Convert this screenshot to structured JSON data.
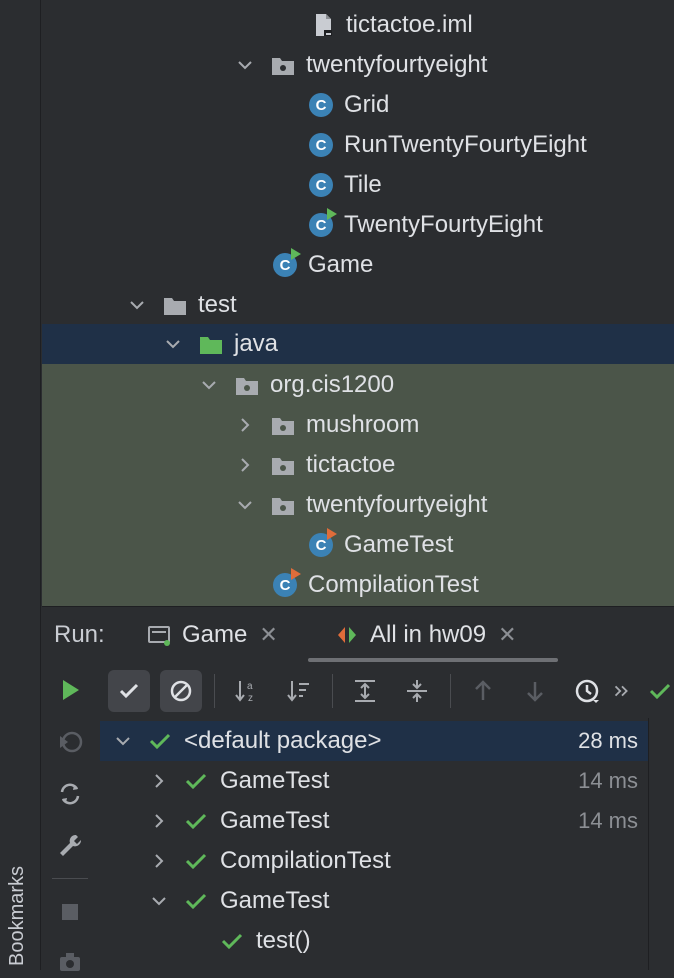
{
  "left_strip": {
    "bookmarks_label": "Bookmarks"
  },
  "project_tree": {
    "rows": [
      {
        "label": "tictactoe.iml",
        "kind": "file"
      },
      {
        "label": "twentyfourtyeight",
        "kind": "package",
        "expanded": true
      },
      {
        "label": "Grid",
        "kind": "class"
      },
      {
        "label": "RunTwentyFourtyEight",
        "kind": "class"
      },
      {
        "label": "Tile",
        "kind": "class"
      },
      {
        "label": "TwentyFourtyEight",
        "kind": "class-runnable"
      },
      {
        "label": "Game",
        "kind": "class-runnable"
      },
      {
        "label": "test",
        "kind": "folder",
        "expanded": true
      },
      {
        "label": "java",
        "kind": "source-root",
        "expanded": true,
        "selected": true
      },
      {
        "label": "org.cis1200",
        "kind": "package",
        "expanded": true
      },
      {
        "label": "mushroom",
        "kind": "package",
        "expanded": false
      },
      {
        "label": "tictactoe",
        "kind": "package",
        "expanded": false
      },
      {
        "label": "twentyfourtyeight",
        "kind": "package",
        "expanded": true
      },
      {
        "label": "GameTest",
        "kind": "test-class"
      },
      {
        "label": "CompilationTest",
        "kind": "test-class"
      }
    ]
  },
  "run_panel": {
    "label": "Run:",
    "tabs": [
      {
        "label": "Game",
        "active": false
      },
      {
        "label": "All in hw09",
        "active": true
      }
    ]
  },
  "results": {
    "rows": [
      {
        "label": "<default package>",
        "duration": "28 ms",
        "status": "passed",
        "expanded": true
      },
      {
        "label": "GameTest",
        "duration": "14 ms",
        "status": "passed",
        "expanded": false
      },
      {
        "label": "GameTest",
        "duration": "14 ms",
        "status": "passed",
        "expanded": false
      },
      {
        "label": "CompilationTest",
        "duration": "",
        "status": "passed",
        "expanded": false
      },
      {
        "label": "GameTest",
        "duration": "",
        "status": "passed",
        "expanded": true
      },
      {
        "label": "test()",
        "duration": "",
        "status": "passed"
      }
    ]
  },
  "colors": {
    "background": "#2b2d30",
    "selection": "#1f3047",
    "highlight": "#4b5549",
    "pass_green": "#5fb85a",
    "class_blue": "#3b82b5"
  }
}
